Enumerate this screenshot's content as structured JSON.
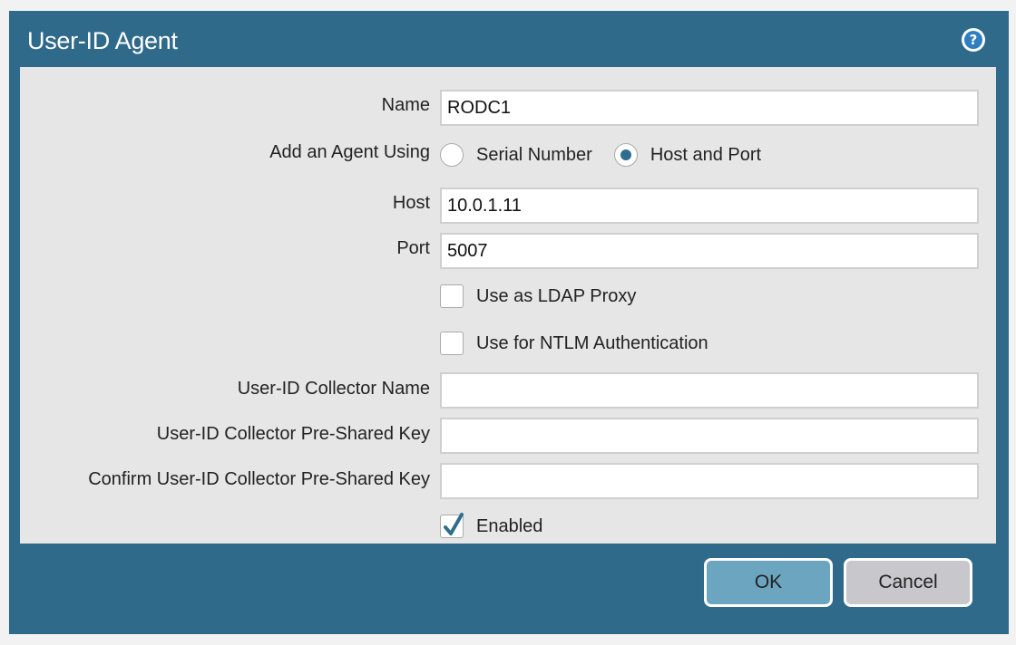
{
  "dialog": {
    "title": "User-ID Agent",
    "help_icon_glyph": "?"
  },
  "form": {
    "name": {
      "label": "Name",
      "value": "RODC1"
    },
    "add_agent": {
      "label": "Add an Agent Using",
      "options": [
        {
          "label": "Serial Number",
          "selected": false
        },
        {
          "label": "Host and Port",
          "selected": true
        }
      ]
    },
    "host": {
      "label": "Host",
      "value": "10.0.1.11"
    },
    "port": {
      "label": "Port",
      "value": "5007"
    },
    "ldap_proxy": {
      "label": "Use as LDAP Proxy",
      "checked": false
    },
    "ntlm_auth": {
      "label": "Use for NTLM Authentication",
      "checked": false
    },
    "collector_name": {
      "label": "User-ID Collector Name",
      "value": ""
    },
    "collector_psk": {
      "label": "User-ID Collector Pre-Shared Key",
      "value": ""
    },
    "confirm_psk": {
      "label": "Confirm User-ID Collector Pre-Shared Key",
      "value": ""
    },
    "enabled": {
      "label": "Enabled",
      "checked": true
    }
  },
  "buttons": {
    "ok": "OK",
    "cancel": "Cancel"
  },
  "colors": {
    "header": "#306a8a",
    "form_bg": "#e6e6e6",
    "ok_button": "#6ba5bf",
    "cancel_button": "#c8c8cc",
    "radio_dot": "#2f6d8e",
    "checkmark": "#2f6d8e"
  }
}
